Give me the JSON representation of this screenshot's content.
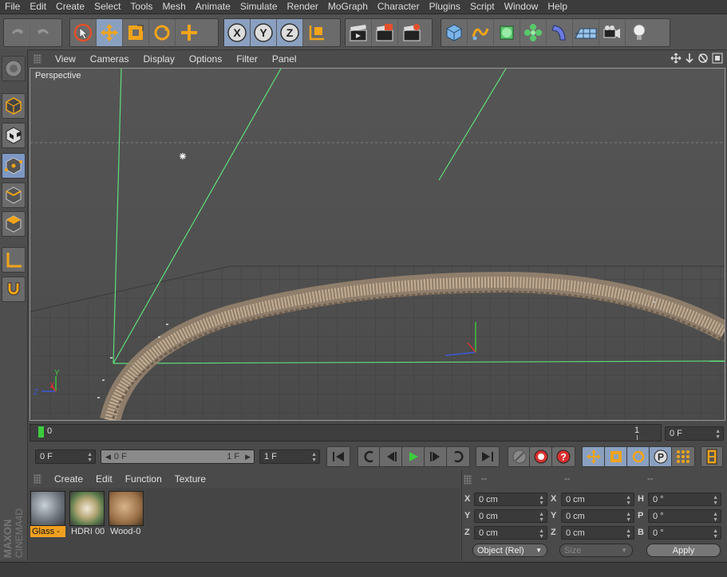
{
  "menu": [
    "File",
    "Edit",
    "Create",
    "Select",
    "Tools",
    "Mesh",
    "Animate",
    "Simulate",
    "Render",
    "MoGraph",
    "Character",
    "Plugins",
    "Script",
    "Window",
    "Help"
  ],
  "viewport": {
    "menu": [
      "View",
      "Cameras",
      "Display",
      "Options",
      "Filter",
      "Panel"
    ],
    "label": "Perspective"
  },
  "timeline": {
    "start_marker": "0",
    "end_marker": "1",
    "current_frame": "0 F"
  },
  "transport": {
    "min_field": "0 F",
    "range_start": "0 F",
    "range_end": "1 F",
    "max_field": "1 F"
  },
  "materials": {
    "menu": [
      "Create",
      "Edit",
      "Function",
      "Texture"
    ],
    "items": [
      {
        "label": "Glass -",
        "selected": true
      },
      {
        "label": "HDRI 00",
        "selected": false
      },
      {
        "label": "Wood-0",
        "selected": false
      }
    ]
  },
  "coordinates": {
    "headers": [
      "--",
      "--",
      "--"
    ],
    "rows": [
      {
        "l1": "X",
        "v1": "0 cm",
        "l2": "X",
        "v2": "0 cm",
        "l3": "H",
        "v3": "0 °"
      },
      {
        "l1": "Y",
        "v1": "0 cm",
        "l2": "Y",
        "v2": "0 cm",
        "l3": "P",
        "v3": "0 °"
      },
      {
        "l1": "Z",
        "v1": "0 cm",
        "l2": "Z",
        "v2": "0 cm",
        "l3": "B",
        "v3": "0 °"
      }
    ],
    "mode_select": "Object (Rel)",
    "size_select": "Size",
    "apply_label": "Apply"
  },
  "branding": {
    "logo_text": "MAXON CINEMA4D"
  },
  "colors": {
    "accent_selected": "#f0a020",
    "active_tool": "#8aa0c0",
    "green_guide": "#5ee07a",
    "play_green": "#3ccc3c"
  }
}
